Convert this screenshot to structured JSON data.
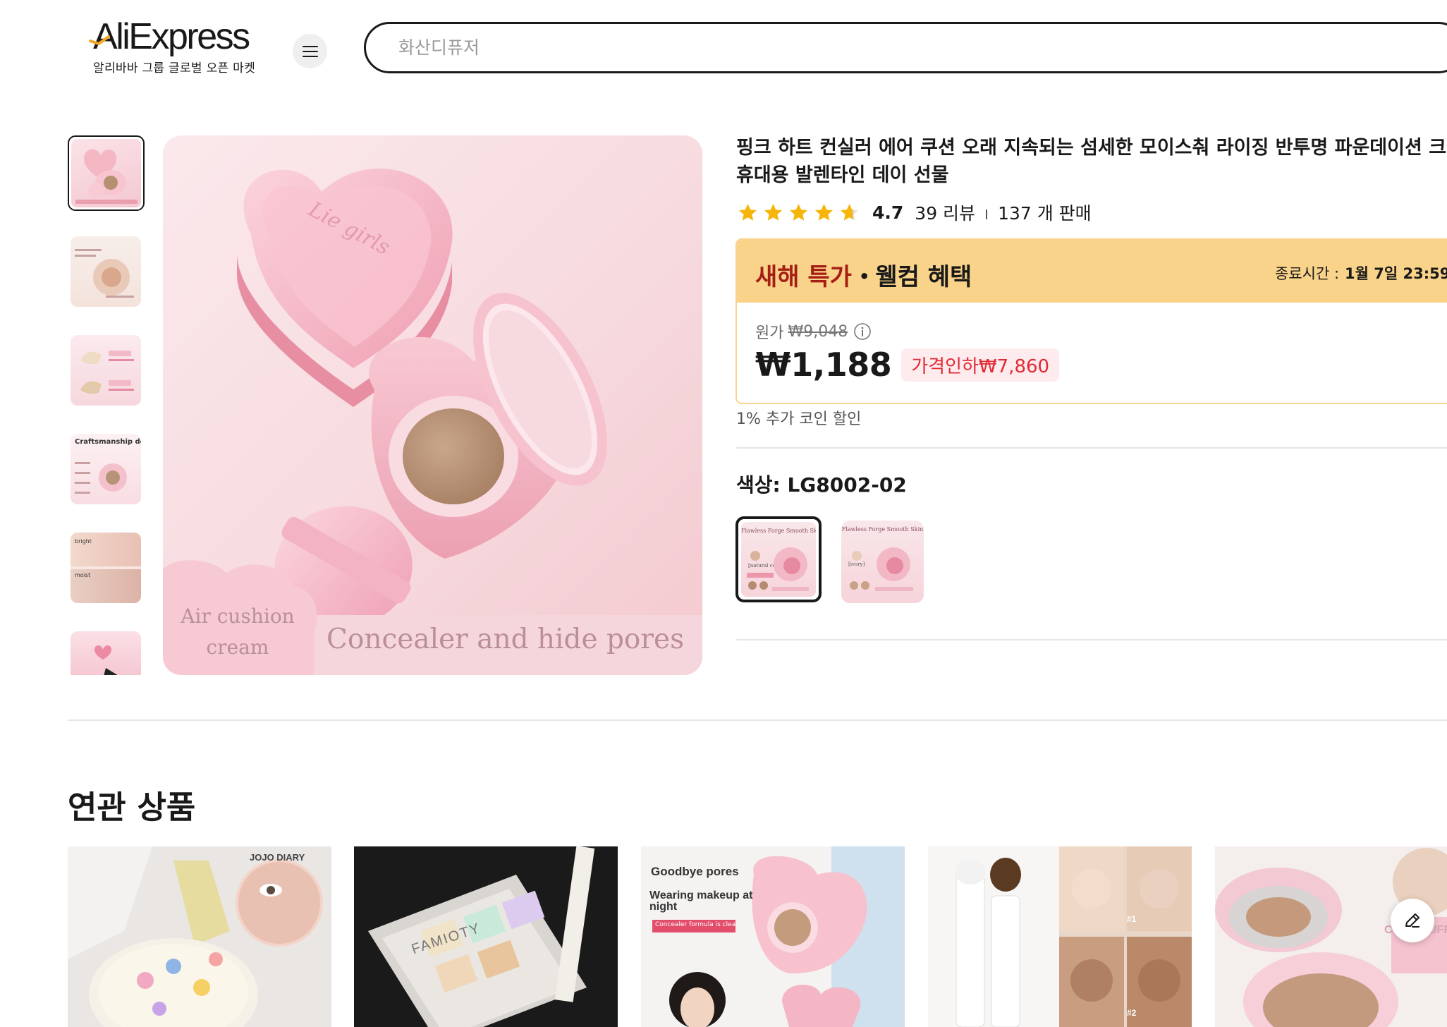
{
  "header": {
    "logo_text": "AliExpress",
    "logo_subtitle": "알리바바 그룹 글로벌 오픈 마켓",
    "search_placeholder": "화산디퓨저"
  },
  "gallery": {
    "thumbnail_captions": [
      "Craftsmanship design",
      "bright",
      "moist"
    ],
    "main_image_caption_left": "Air cushion cream",
    "main_image_caption_right": "Concealer and hide pores"
  },
  "product": {
    "title_line1": "핑크 하트 컨실러 에어 쿠션 오래 지속되는 섬세한 모이스춰 라이징 반투명 파운데이션 크",
    "title_line2": "휴대용 발렌타인 데이 선물",
    "rating": "4.7",
    "stars": 4.7,
    "reviews": "39 리뷰",
    "sold": "137 개 판매"
  },
  "promo": {
    "title_red": "새해 특가",
    "title_dot": "•",
    "title_rest": "웰컴 혜택",
    "ends_label": "종료시간 :",
    "ends_time": "1월 7일 23:59",
    "original_label": "원가",
    "original_price": "₩9,048",
    "price": "₩1,188",
    "discount": "가격인하₩7,860",
    "coin_discount": "1% 추가 코인 할인"
  },
  "variant": {
    "label": "색상: LG8002-02",
    "swatches": [
      {
        "title": "Flawless Forge Smooth Skin",
        "sub": "[natural color]"
      },
      {
        "title": "Flawless Forge Smooth Skin",
        "sub": "[ivory]"
      }
    ]
  },
  "related": {
    "title": "연관 상품",
    "cards": [
      {
        "text1": "JOJO DIARY"
      },
      {
        "text1": "FAMIOTY"
      },
      {
        "text1": "Goodbye pores",
        "text2": "Wearing makeup at night",
        "band": "Concealer formula is clear and natural"
      },
      {
        "text1": "#1",
        "text2": "#2"
      },
      {
        "text1": "COCO PUFF"
      }
    ]
  },
  "colors": {
    "brand_red": "#a51e16",
    "promo_bg": "#f9d389",
    "discount_red": "#e02b35",
    "star": "#f5b50a"
  }
}
